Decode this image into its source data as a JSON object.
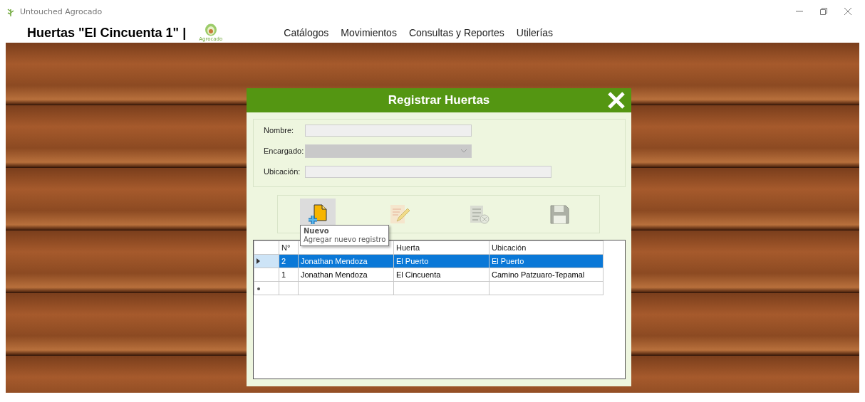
{
  "window": {
    "title": "Untouched Agrocado"
  },
  "header": {
    "title": "Huertas \"El Cincuenta 1\" |",
    "logo_caption": "Agrocado"
  },
  "menu": [
    {
      "label": "Catálogos"
    },
    {
      "label": "Movimientos"
    },
    {
      "label": "Consultas y Reportes"
    },
    {
      "label": "Utilerías"
    }
  ],
  "dialog": {
    "title": "Registrar Huertas",
    "fields": [
      {
        "label": "Nombre:",
        "kind": "text"
      },
      {
        "label": "Encargado:",
        "kind": "combo"
      },
      {
        "label": "Ubicación:",
        "kind": "long_text"
      }
    ],
    "toolbar": [
      {
        "kind": "new",
        "hovered": true,
        "disabled": false
      },
      {
        "kind": "edit",
        "hovered": false,
        "disabled": true
      },
      {
        "kind": "delete",
        "hovered": false,
        "disabled": true
      },
      {
        "kind": "save",
        "hovered": false,
        "disabled": true
      }
    ],
    "tooltip": {
      "title": "Nuevo",
      "text": "Agregar nuevo registro"
    },
    "table": {
      "columns": [
        {
          "label": "N°"
        },
        {},
        {
          "label": "Huerta"
        },
        {
          "label": "Ubicación"
        }
      ],
      "rows": [
        {
          "selected": true,
          "cells": [
            "2",
            "Jonathan Mendoza",
            "El Puerto",
            "El Puerto"
          ]
        },
        {
          "selected": false,
          "cells": [
            "1",
            "Jonathan Mendoza",
            "El Cincuenta",
            "Camino Patzuaro-Tepamal"
          ]
        }
      ],
      "new_row": true
    }
  }
}
